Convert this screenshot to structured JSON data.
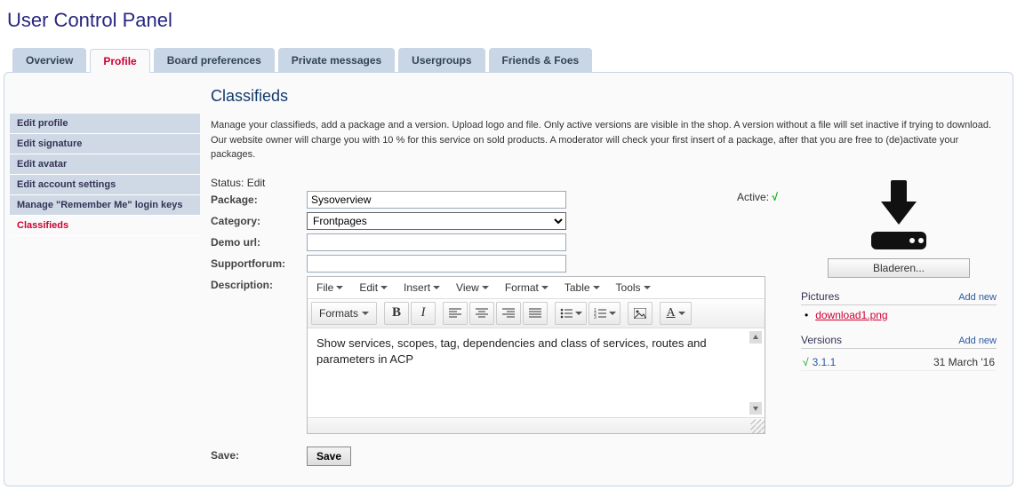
{
  "page_title": "User Control Panel",
  "tabs": [
    {
      "label": "Overview",
      "active": false
    },
    {
      "label": "Profile",
      "active": true
    },
    {
      "label": "Board preferences",
      "active": false
    },
    {
      "label": "Private messages",
      "active": false
    },
    {
      "label": "Usergroups",
      "active": false
    },
    {
      "label": "Friends & Foes",
      "active": false
    }
  ],
  "sidebar": [
    {
      "label": "Edit profile",
      "active": false
    },
    {
      "label": "Edit signature",
      "active": false
    },
    {
      "label": "Edit avatar",
      "active": false
    },
    {
      "label": "Edit account settings",
      "active": false
    },
    {
      "label": "Manage \"Remember Me\" login keys",
      "active": false
    },
    {
      "label": "Classifieds",
      "active": true
    }
  ],
  "main": {
    "heading": "Classifieds",
    "intro": "Manage your classifieds, add a package and a version. Upload logo and file. Only active versions are visible in the shop. A version without a file will set inactive if trying to download. Our website owner will charge you with 10 % for this service on sold products. A moderator will check your first insert of a package, after that you are free to (de)activate your packages.",
    "status_label": "Status:",
    "status_value": "Edit",
    "fields": {
      "package_label": "Package:",
      "package_value": "Sysoverview",
      "category_label": "Category:",
      "category_value": "Frontpages",
      "demo_label": "Demo url:",
      "demo_value": "",
      "support_label": "Supportforum:",
      "support_value": "",
      "description_label": "Description:",
      "active_label": "Active:",
      "active_checked": "√"
    },
    "editor": {
      "menu": [
        "File",
        "Edit",
        "Insert",
        "View",
        "Format",
        "Table",
        "Tools"
      ],
      "formats_label": "Formats",
      "content": "Show services, scopes, tag, dependencies and class of services, routes and parameters in ACP"
    },
    "save_label": "Save:",
    "save_button": "Save"
  },
  "right": {
    "browse_button": "Bladeren...",
    "pictures_title": "Pictures",
    "add_new": "Add new",
    "pictures": [
      {
        "name": "download1.png"
      }
    ],
    "versions_title": "Versions",
    "versions": [
      {
        "name": "3.1.1",
        "date": "31 March '16",
        "active": true
      }
    ]
  },
  "icons": {
    "bold": "B",
    "italic": "I"
  }
}
